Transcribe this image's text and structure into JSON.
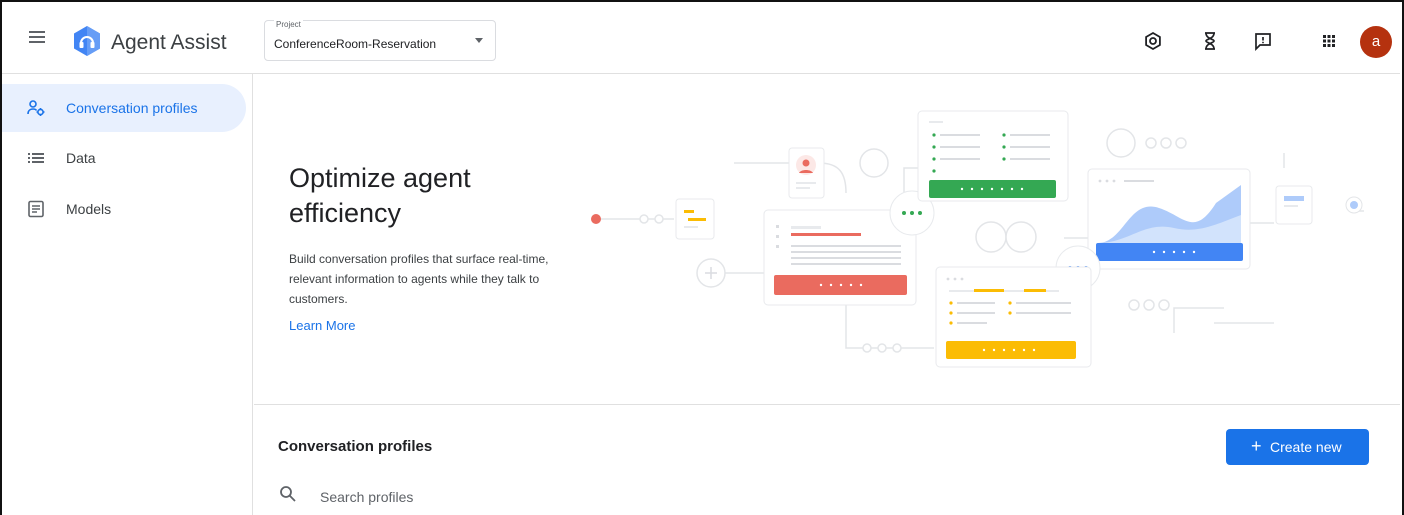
{
  "header": {
    "app_title": "Agent Assist",
    "project_label": "Project",
    "project_value": "ConferenceRoom-Reservation",
    "avatar_letter": "a",
    "avatar_color": "#b5320f"
  },
  "sidebar": {
    "items": [
      {
        "label": "Conversation profiles",
        "icon": "profiles-icon",
        "active": true
      },
      {
        "label": "Data",
        "icon": "list-icon",
        "active": false
      },
      {
        "label": "Models",
        "icon": "document-icon",
        "active": false
      }
    ]
  },
  "hero": {
    "title": "Optimize agent efficiency",
    "description": "Build conversation profiles that surface real-time, relevant information to agents while they talk to customers.",
    "link": "Learn More"
  },
  "main": {
    "section_title": "Conversation profiles",
    "create_button": "Create new",
    "search_placeholder": "Search profiles"
  },
  "colors": {
    "accent": "#1a73e8",
    "green": "#34a853",
    "red": "#ea6b5f",
    "yellow": "#fbbc04"
  }
}
